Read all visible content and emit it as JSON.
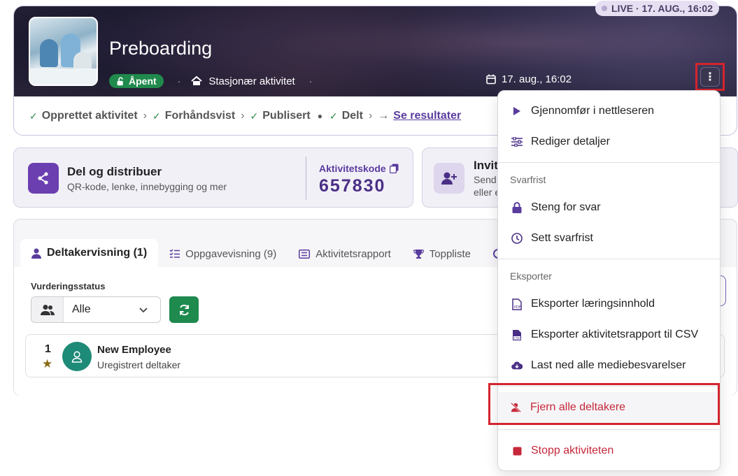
{
  "header": {
    "live_badge": "LIVE · 17. AUG., 16:02",
    "title": "Preboarding",
    "status_badge": "Åpent",
    "activity_type": "Stasjonær aktivitet",
    "date": "17. aug., 16:02"
  },
  "steps": {
    "created": "Opprettet aktivitet",
    "previewed": "Forhåndsvist",
    "published": "Publisert",
    "shared": "Delt",
    "results": "Se resultater"
  },
  "share": {
    "title": "Del og distribuer",
    "subtitle": "QR-kode, lenke, innebygging og mer",
    "code_label": "Aktivitetskode",
    "code_value": "657830"
  },
  "invite": {
    "title": "Invit",
    "line1": "Send",
    "line2": "eller e"
  },
  "tabs": [
    {
      "label": "Deltakervisning (1)"
    },
    {
      "label": "Oppgavevisning (9)"
    },
    {
      "label": "Aktivitetsrapport"
    },
    {
      "label": "Toppliste"
    }
  ],
  "filter": {
    "label": "Vurderingsstatus",
    "value": "Alle"
  },
  "participants": [
    {
      "rank": "1",
      "name": "New Employee",
      "status": "Uregistrert deltaker"
    }
  ],
  "menu": {
    "run_in_browser": "Gjennomfør i nettleseren",
    "edit_details": "Rediger detaljer",
    "section_deadline": "Svarfrist",
    "close_answers": "Steng for svar",
    "set_deadline": "Sett svarfrist",
    "section_export": "Eksporter",
    "export_content": "Eksporter læringsinnhold",
    "export_csv": "Eksporter aktivitetsrapport til CSV",
    "download_media": "Last ned alle mediebesvarelser",
    "remove_participants": "Fjern alle deltakere",
    "stop_activity": "Stopp aktiviteten"
  },
  "colors": {
    "accent": "#5a3c9e",
    "success": "#1f8a4c",
    "danger": "#c6283a",
    "highlight": "#d4242c"
  }
}
